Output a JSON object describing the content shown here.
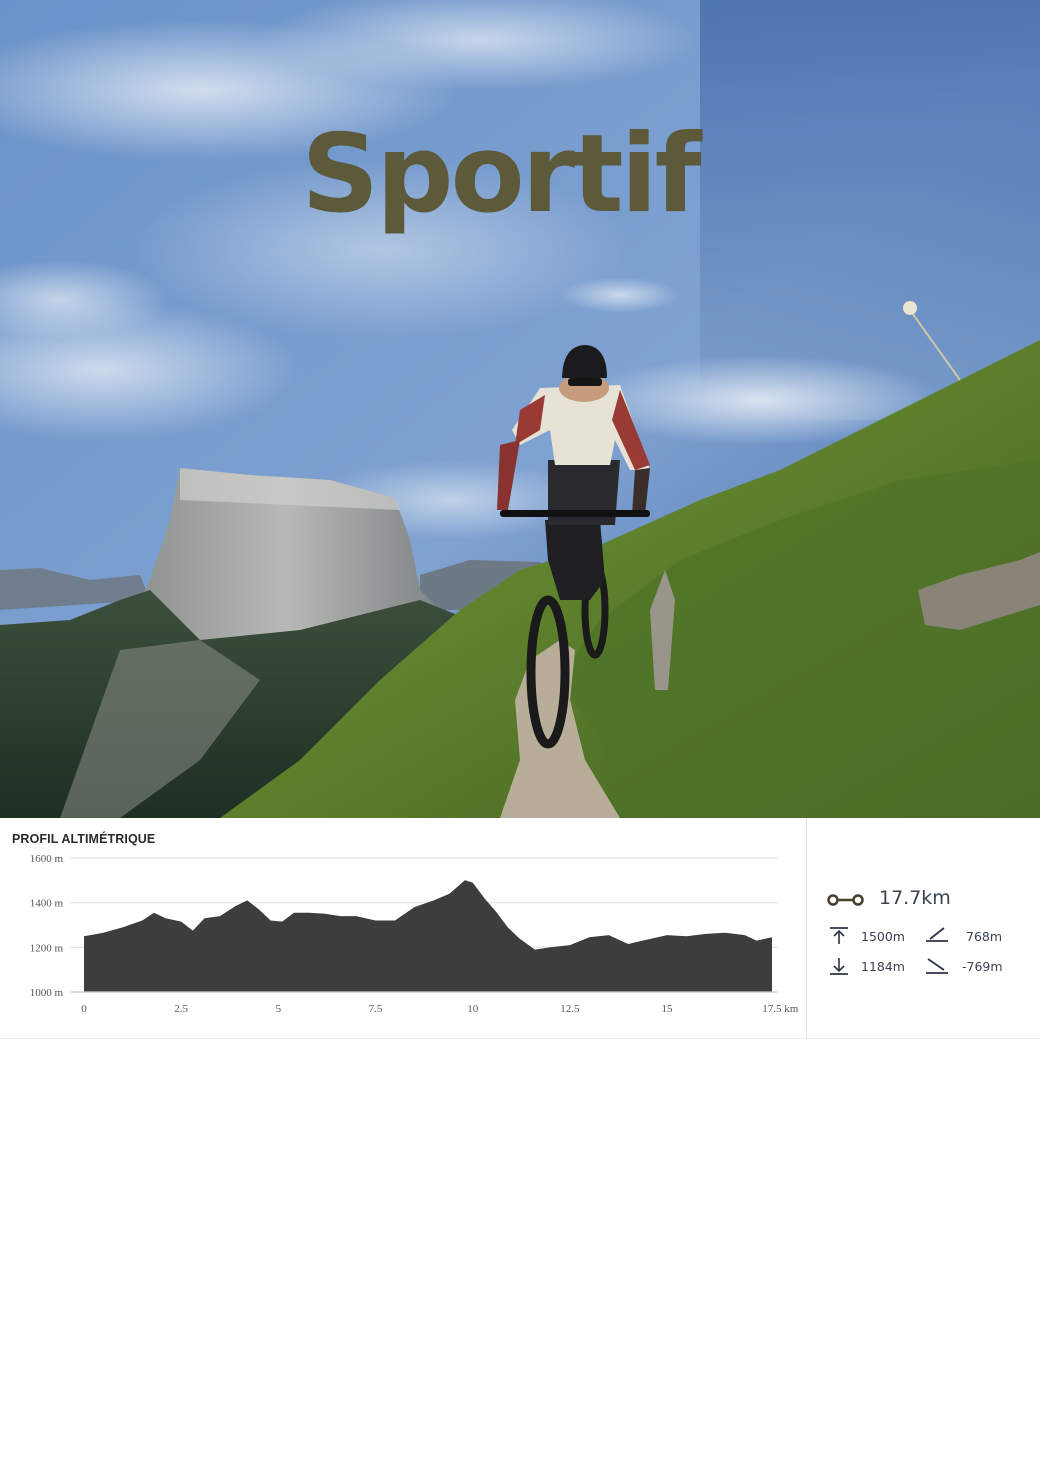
{
  "hero": {
    "title": "Sportif",
    "title_color": "#5d5a3c"
  },
  "profile": {
    "heading": "PROFIL ALTIMÉTRIQUE",
    "fill_color": "#3d3d3d"
  },
  "chart_data": {
    "type": "area",
    "title": "PROFIL ALTIMÉTRIQUE",
    "xlabel": "",
    "ylabel": "",
    "x_unit": "km",
    "y_unit": "m",
    "xlim": [
      0,
      17.7
    ],
    "ylim": [
      1000,
      1600
    ],
    "x_ticks": [
      "0",
      "2.5",
      "5",
      "7.5",
      "10",
      "12.5",
      "15",
      "17.5 km"
    ],
    "y_ticks": [
      "1600 m",
      "1400 m",
      "1200 m",
      "1000 m"
    ],
    "grid": true,
    "series": [
      {
        "x": [
          0,
          0.5,
          1.0,
          1.5,
          1.8,
          2.1,
          2.5,
          2.8,
          3.1,
          3.5,
          3.9,
          4.2,
          4.5,
          4.8,
          5.1,
          5.4,
          5.8,
          6.2,
          6.6,
          7.0,
          7.5,
          8.0,
          8.5,
          9.0,
          9.4,
          9.8,
          10.0,
          10.3,
          10.6,
          10.9,
          11.2,
          11.6,
          12.0,
          12.5,
          13.0,
          13.5,
          14.0,
          14.5,
          15.0,
          15.5,
          16.0,
          16.5,
          17.0,
          17.3,
          17.7
        ],
        "y": [
          1250,
          1265,
          1290,
          1320,
          1355,
          1330,
          1315,
          1275,
          1330,
          1340,
          1385,
          1410,
          1370,
          1320,
          1315,
          1355,
          1355,
          1350,
          1340,
          1340,
          1320,
          1320,
          1380,
          1410,
          1440,
          1500,
          1490,
          1420,
          1360,
          1290,
          1240,
          1190,
          1200,
          1210,
          1245,
          1255,
          1215,
          1235,
          1255,
          1250,
          1260,
          1265,
          1255,
          1230,
          1245
        ]
      }
    ]
  },
  "stats": {
    "distance": "17.7km",
    "max_alt": "1500m",
    "min_alt": "1184m",
    "ascent": "768m",
    "descent": "-769m",
    "icon_color": "#4a3f2a"
  }
}
